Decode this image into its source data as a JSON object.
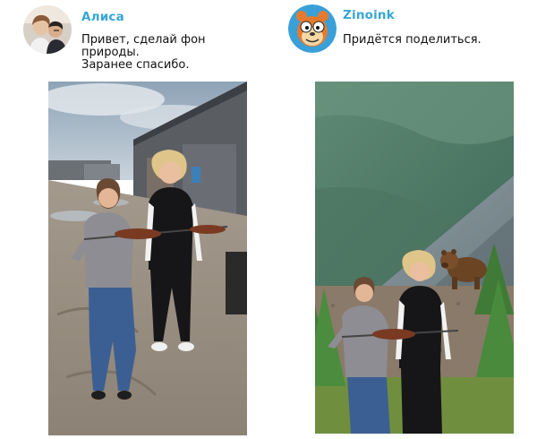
{
  "left_post": {
    "username": "Алиса",
    "message_lines": [
      "Привет, сделай фон",
      "природы.",
      "Заранее спасибо."
    ],
    "avatar_icon": "couple-selfie-avatar",
    "photo_icon": "original-garage-photo"
  },
  "right_post": {
    "username": "Zinoink",
    "message_lines": [
      "Придётся поделиться."
    ],
    "avatar_icon": "cartoon-bear-avatar",
    "photo_icon": "edited-mountain-bear-photo"
  },
  "colors": {
    "username": "#37a7d4",
    "text": "#111111",
    "avatar_ring": "#3aa0d8"
  }
}
